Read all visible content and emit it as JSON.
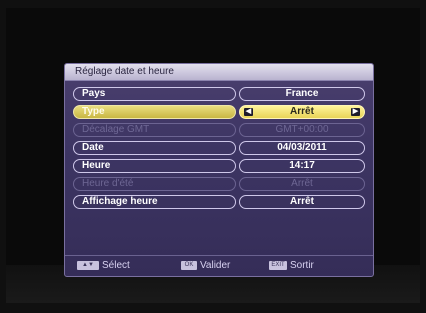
{
  "dialog": {
    "title": "Réglage date et heure"
  },
  "rows": [
    {
      "label": "Pays",
      "value": "France",
      "state": "normal"
    },
    {
      "label": "Type",
      "value": "Arrêt",
      "state": "selected"
    },
    {
      "label": "Décalage GMT",
      "value": "GMT+00:00",
      "state": "disabled"
    },
    {
      "label": "Date",
      "value": "04/03/2011",
      "state": "normal"
    },
    {
      "label": "Heure",
      "value": "14:17",
      "state": "normal"
    },
    {
      "label": "Heure d'été",
      "value": "Arrêt",
      "state": "disabled"
    },
    {
      "label": "Affichage heure",
      "value": "Arrêt",
      "state": "normal"
    }
  ],
  "footer": {
    "select_key": "▲▼",
    "select_label": "Sélect",
    "ok_key": "OK",
    "ok_label": "Valider",
    "exit_key": "EXIT",
    "exit_label": "Sortir"
  },
  "icons": {
    "left_arrow": "chevron-left-icon",
    "right_arrow": "chevron-right-icon"
  }
}
